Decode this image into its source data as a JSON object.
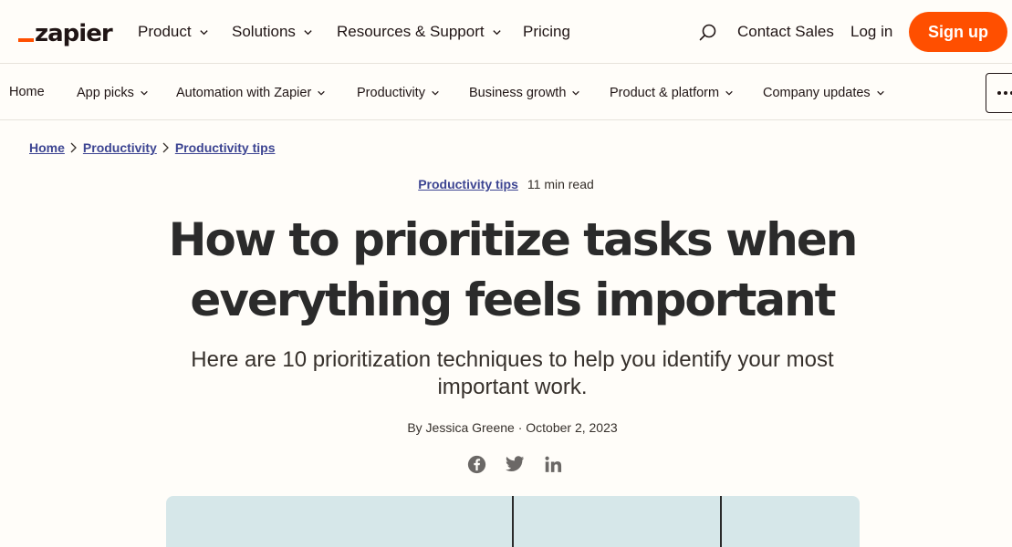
{
  "header": {
    "logo_text": "zapier",
    "nav": [
      "Product",
      "Solutions",
      "Resources & Support",
      "Pricing"
    ],
    "search_icon": "search-icon",
    "contact_sales": "Contact Sales",
    "login": "Log in",
    "signup": "Sign up",
    "accent_color": "#ff4f00"
  },
  "subnav": {
    "items": [
      {
        "label": "Home"
      },
      {
        "label": "App picks"
      },
      {
        "label": "Automation with Zapier"
      },
      {
        "label": "Productivity"
      },
      {
        "label": "Business growth"
      },
      {
        "label": "Product & platform"
      },
      {
        "label": "Company updates"
      }
    ],
    "more_icon": "more-icon"
  },
  "breadcrumb": [
    "Home",
    "Productivity",
    "Productivity tips"
  ],
  "article": {
    "category": "Productivity tips",
    "read_time": "11 min read",
    "title_line1": "How to prioritize tasks when",
    "title_line2": "everything feels important",
    "subtitle": "Here are 10 prioritization techniques to help you identify your most important work.",
    "byline": "By Jessica Greene · October 2, 2023",
    "share_icons": [
      "facebook-icon",
      "twitter-icon",
      "linkedin-icon"
    ]
  }
}
